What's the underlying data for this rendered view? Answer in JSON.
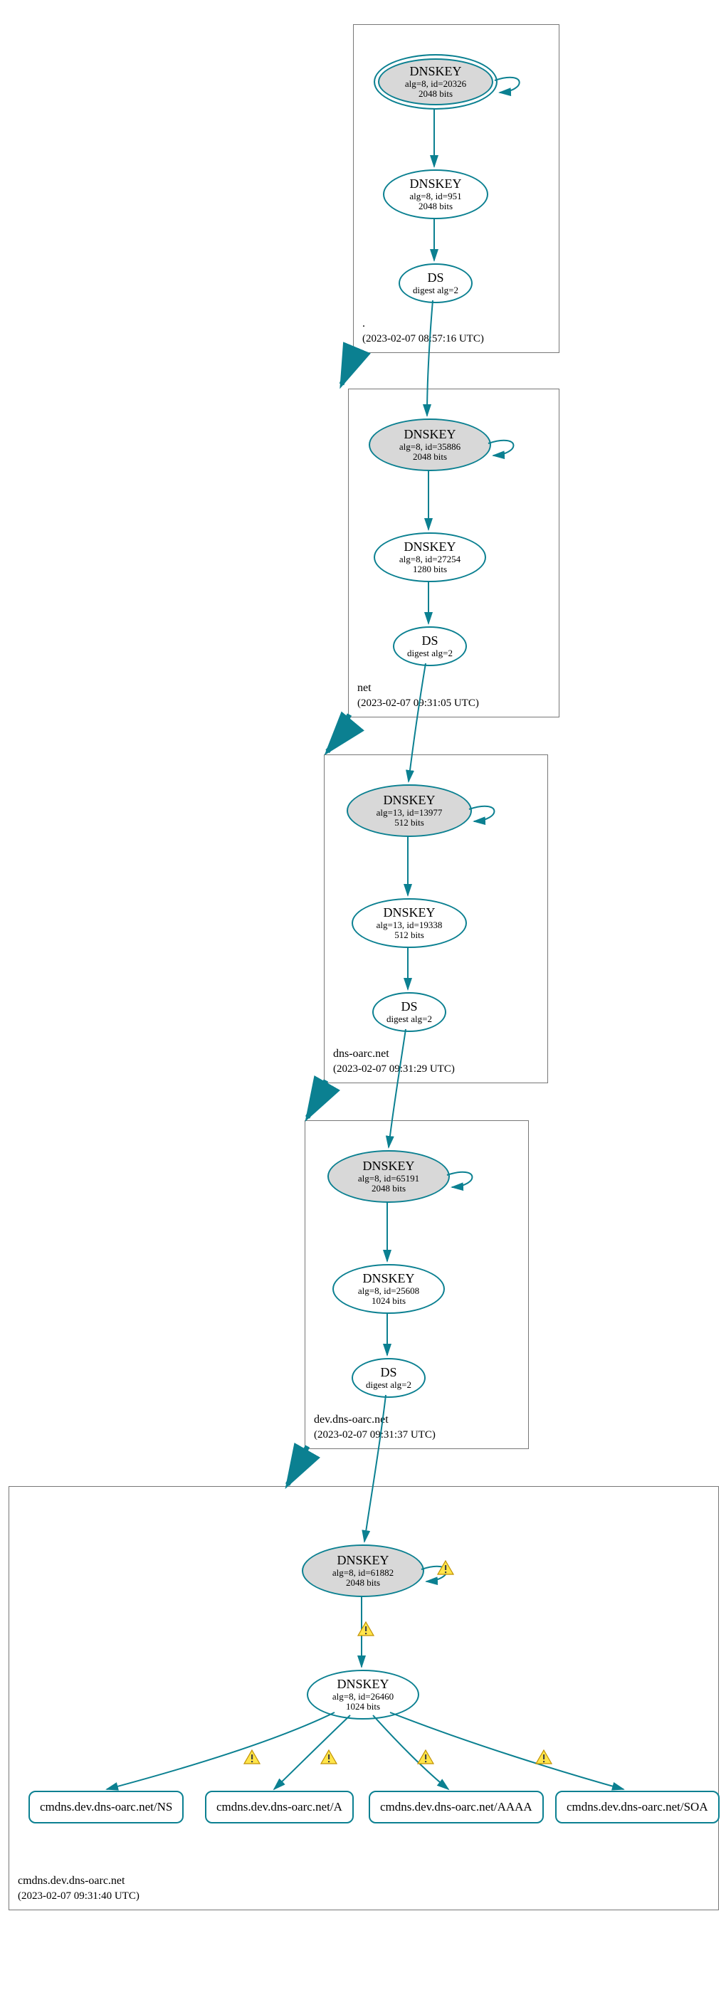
{
  "chart_data": {
    "type": "dnssec-chain",
    "zones": [
      {
        "name": ".",
        "timestamp": "(2023-02-07 08:57:16 UTC)",
        "nodes": [
          {
            "kind": "ksk",
            "title": "DNSKEY",
            "sub1": "alg=8, id=20326",
            "sub2": "2048 bits",
            "double": true
          },
          {
            "kind": "zsk",
            "title": "DNSKEY",
            "sub1": "alg=8, id=951",
            "sub2": "2048 bits"
          },
          {
            "kind": "ds",
            "title": "DS",
            "sub1": "digest alg=2"
          }
        ]
      },
      {
        "name": "net",
        "timestamp": "(2023-02-07 09:31:05 UTC)",
        "nodes": [
          {
            "kind": "ksk",
            "title": "DNSKEY",
            "sub1": "alg=8, id=35886",
            "sub2": "2048 bits"
          },
          {
            "kind": "zsk",
            "title": "DNSKEY",
            "sub1": "alg=8, id=27254",
            "sub2": "1280 bits"
          },
          {
            "kind": "ds",
            "title": "DS",
            "sub1": "digest alg=2"
          }
        ]
      },
      {
        "name": "dns-oarc.net",
        "timestamp": "(2023-02-07 09:31:29 UTC)",
        "nodes": [
          {
            "kind": "ksk",
            "title": "DNSKEY",
            "sub1": "alg=13, id=13977",
            "sub2": "512 bits"
          },
          {
            "kind": "zsk",
            "title": "DNSKEY",
            "sub1": "alg=13, id=19338",
            "sub2": "512 bits"
          },
          {
            "kind": "ds",
            "title": "DS",
            "sub1": "digest alg=2"
          }
        ]
      },
      {
        "name": "dev.dns-oarc.net",
        "timestamp": "(2023-02-07 09:31:37 UTC)",
        "nodes": [
          {
            "kind": "ksk",
            "title": "DNSKEY",
            "sub1": "alg=8, id=65191",
            "sub2": "2048 bits"
          },
          {
            "kind": "zsk",
            "title": "DNSKEY",
            "sub1": "alg=8, id=25608",
            "sub2": "1024 bits"
          },
          {
            "kind": "ds",
            "title": "DS",
            "sub1": "digest alg=2"
          }
        ]
      },
      {
        "name": "cmdns.dev.dns-oarc.net",
        "timestamp": "(2023-02-07 09:31:40 UTC)",
        "nodes": [
          {
            "kind": "ksk",
            "title": "DNSKEY",
            "sub1": "alg=8, id=61882",
            "sub2": "2048 bits",
            "warn_self": true,
            "warn_down": true
          },
          {
            "kind": "zsk",
            "title": "DNSKEY",
            "sub1": "alg=8, id=26460",
            "sub2": "1024 bits"
          }
        ],
        "records": [
          {
            "label": "cmdns.dev.dns-oarc.net/NS",
            "warn": true
          },
          {
            "label": "cmdns.dev.dns-oarc.net/A",
            "warn": true
          },
          {
            "label": "cmdns.dev.dns-oarc.net/AAAA",
            "warn": true
          },
          {
            "label": "cmdns.dev.dns-oarc.net/SOA",
            "warn": true
          }
        ]
      }
    ]
  }
}
